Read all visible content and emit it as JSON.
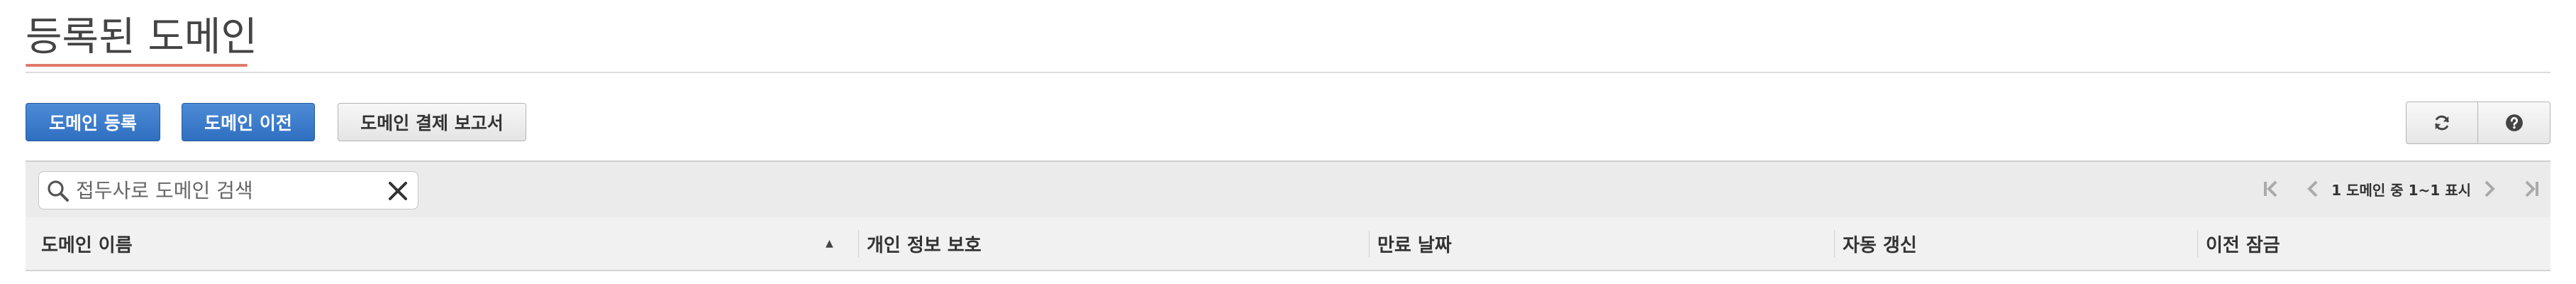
{
  "page": {
    "title": "등록된 도메인"
  },
  "toolbar": {
    "register_label": "도메인 등록",
    "transfer_label": "도메인 이전",
    "report_label": "도메인 결제 보고서",
    "refresh_icon": "refresh-icon",
    "help_icon": "help-icon"
  },
  "search": {
    "placeholder": "접두사로 도메인 검색",
    "value": ""
  },
  "pagination": {
    "text": "1 도메인 중 1~1 표시"
  },
  "table": {
    "columns": [
      {
        "label": "도메인 이름",
        "sorted": "ascending"
      },
      {
        "label": "개인 정보 보호"
      },
      {
        "label": "만료 날짜"
      },
      {
        "label": "자동 갱신"
      },
      {
        "label": "이전 잠금"
      }
    ],
    "rows": []
  },
  "colors": {
    "primary_button": "#2f6fc0",
    "title_underline": "#e07b6a"
  }
}
